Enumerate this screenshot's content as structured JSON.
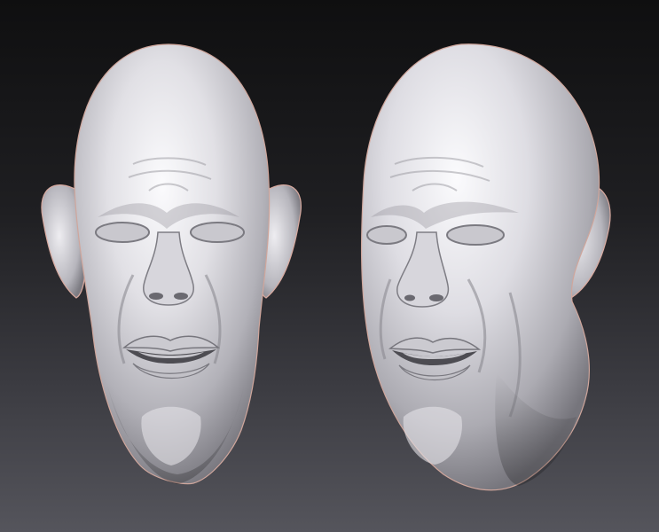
{
  "scene": {
    "subject_count": 2,
    "render_style": "clay sculpt render",
    "background_gradient": [
      "#0f0f10",
      "#1f1f22",
      "#3b3b41",
      "#55555c"
    ],
    "material_colors": {
      "clay_light": "#f4f3f6",
      "clay_mid": "#bdbcc2",
      "clay_dark": "#6f6e75",
      "rim_warm": "#e3b7ad"
    }
  },
  "views": [
    {
      "view": "front"
    },
    {
      "view": "three-quarter"
    }
  ]
}
